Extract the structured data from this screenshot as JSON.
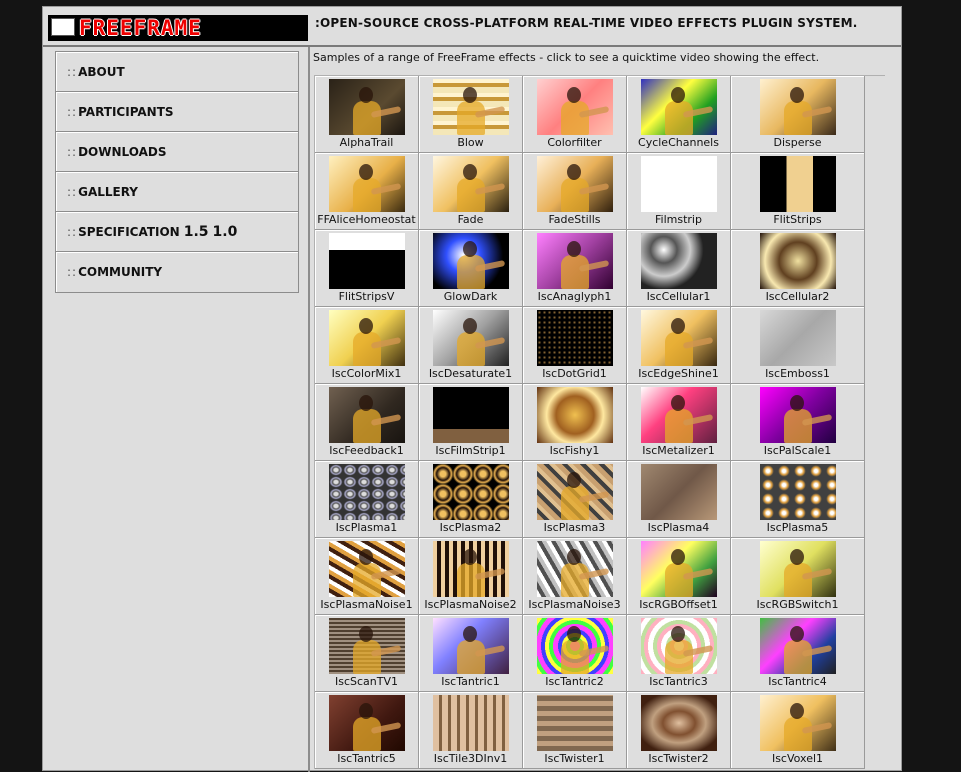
{
  "header": {
    "logo_text": "FREEFRAME",
    "tagline": ":OPEN-SOURCE CROSS-PLATFORM REAL-TIME VIDEO EFFECTS PLUGIN SYSTEM."
  },
  "sidebar": {
    "prefix": "::",
    "items": [
      {
        "label": "ABOUT"
      },
      {
        "label": "PARTICIPANTS"
      },
      {
        "label": "DOWNLOADS"
      },
      {
        "label": "GALLERY"
      },
      {
        "label": "SPECIFICATION",
        "versions": [
          "1.5",
          "1.0"
        ]
      },
      {
        "label": "COMMUNITY"
      }
    ]
  },
  "main": {
    "intro": "Samples of a range of FreeFrame effects - click to see a quicktime video showing the effect."
  },
  "effects": [
    {
      "name": "AlphaTrail",
      "bg": "linear-gradient(135deg,#2a2218,#5a4a30 60%,#1a1510)",
      "fig": true
    },
    {
      "name": "Blow",
      "bg": "repeating-linear-gradient(0deg,#f4e7b8 0 6px,#c89838 6px 10px,#fff4d0 10px 14px)",
      "fig": true
    },
    {
      "name": "Colorfilter",
      "bg": "linear-gradient(135deg,#ffd0d0,#ff8080 50%,#ffc0b0)",
      "fig": true
    },
    {
      "name": "CycleChannels",
      "bg": "linear-gradient(135deg,#3030c0,#ffff40 40%,#20a020 70%,#202080)",
      "fig": true
    },
    {
      "name": "Disperse",
      "bg": "linear-gradient(135deg,#fff0d0,#e8b860 50%,#3a2a1a)",
      "fig": true
    },
    {
      "name": "FFAliceHomeostat",
      "bg": "linear-gradient(135deg,#fff0c0,#e8b048 55%,#3a2a10)",
      "fig": true
    },
    {
      "name": "Fade",
      "bg": "linear-gradient(135deg,#fff6e0,#f0c060 50%,#2a2010)",
      "fig": true
    },
    {
      "name": "FadeStills",
      "bg": "linear-gradient(135deg,#fff0d8,#e8b058 50%,#30200e)",
      "fig": true
    },
    {
      "name": "Filmstrip",
      "bg": "linear-gradient(90deg,#fff,#fff)",
      "fig": false
    },
    {
      "name": "FlitStrips",
      "bg": "linear-gradient(90deg,#000 0 35%,#f0d090 35% 70%,#000 70%)",
      "fig": false
    },
    {
      "name": "FlitStripsV",
      "bg": "linear-gradient(180deg,#fff 0 30%,#000 30%)",
      "fig": false
    },
    {
      "name": "GlowDark",
      "bg": "radial-gradient(circle at 40% 40%,#ffffff,#3050ff 30%,#000 70%)",
      "fig": true
    },
    {
      "name": "IscAnaglyph1",
      "bg": "linear-gradient(135deg,#ff80ff,#a040a0 50%,#300030)",
      "fig": true
    },
    {
      "name": "IscCellular1",
      "bg": "radial-gradient(circle at 30% 30%,#fff,#555 20%,#ccc 40%,#222 60%)",
      "fig": false
    },
    {
      "name": "IscCellular2",
      "bg": "radial-gradient(circle at 50% 50%,#f0e0a0,#604020 40%,#f8e8b0 70%,#201008)",
      "fig": false
    },
    {
      "name": "IscColorMix1",
      "bg": "linear-gradient(135deg,#ffffc0,#f0d050 50%,#403010)",
      "fig": true
    },
    {
      "name": "IscDesaturate1",
      "bg": "linear-gradient(135deg,#ffffff,#a0a0a0 50%,#202020)",
      "fig": true
    },
    {
      "name": "IscDotGrid1",
      "bg": "radial-gradient(circle,#806030 30%,#000 31%) 0 0/5px 5px",
      "fig": false
    },
    {
      "name": "IscEdgeShine1",
      "bg": "linear-gradient(135deg,#fff8e0,#f0c060 50%,#382810)",
      "fig": true
    },
    {
      "name": "IscEmboss1",
      "bg": "linear-gradient(135deg,#d8d8d8,#a8a8a8 50%,#c8c8c8)",
      "fig": false
    },
    {
      "name": "IscFeedback1",
      "bg": "linear-gradient(135deg,#706050,#302820 60%,#181410)",
      "fig": true
    },
    {
      "name": "IscFilmStrip1",
      "bg": "linear-gradient(180deg,#000 0 75%,#806040 75%)",
      "fig": false
    },
    {
      "name": "IscFishy1",
      "bg": "radial-gradient(circle at 50% 50%,#f0c050,#a06020 40%,#ffe8a0 60%,#603010)",
      "fig": false
    },
    {
      "name": "IscMetalizer1",
      "bg": "linear-gradient(135deg,#ffffff,#ff4080 40%,#602040)",
      "fig": true
    },
    {
      "name": "IscPalScale1",
      "bg": "linear-gradient(135deg,#ff00ff,#8000a0 50%,#200040)",
      "fig": true
    },
    {
      "name": "IscPlasma1",
      "bg": "radial-gradient(ellipse,#ddd 20%,#555 35%,#aac 50%,#333 65%) 0 0/14px 12px",
      "fig": false
    },
    {
      "name": "IscPlasma2",
      "bg": "radial-gradient(circle,#f0c060 20%,#201008 45%,#e8b050 60%,#000 75%) 0 0/20px 20px",
      "fig": false
    },
    {
      "name": "IscPlasma3",
      "bg": "repeating-linear-gradient(45deg,#c8a070 0 5px,#404040 5px 9px,#e0c090 9px 13px)",
      "fig": true
    },
    {
      "name": "IscPlasma4",
      "bg": "linear-gradient(135deg,#a08870,#705848 50%,#b89878)",
      "fig": false
    },
    {
      "name": "IscPlasma5",
      "bg": "radial-gradient(circle,#ffffff 15%,#e0a040 35%,#404040 55%) 0 0/16px 14px",
      "fig": false
    },
    {
      "name": "IscPlasmaNoise1",
      "bg": "repeating-linear-gradient(30deg,#fff 0 4px,#402010 4px 8px,#e0a040 8px 12px)",
      "fig": true
    },
    {
      "name": "IscPlasmaNoise2",
      "bg": "repeating-linear-gradient(90deg,#f0d0a0 0 4px,#201008 4px 8px),repeating-linear-gradient(0deg,#a07040 0 5px,transparent 5px 10px)",
      "fig": true
    },
    {
      "name": "IscPlasmaNoise3",
      "bg": "repeating-linear-gradient(60deg,#fff 0 4px,#505050 4px 8px,#c0c0c0 8px 12px)",
      "fig": true
    },
    {
      "name": "IscRGBOffset1",
      "bg": "linear-gradient(135deg,#ff80ff,#ffff60 40%,#40a040 70%,#200020)",
      "fig": true
    },
    {
      "name": "IscRGBSwitch1",
      "bg": "linear-gradient(135deg,#ffffd0,#e0e060 50%,#303010)",
      "fig": true
    },
    {
      "name": "IscScanTV1",
      "bg": "repeating-linear-gradient(0deg,#a09080 0 2px,#504030 2px 4px)",
      "fig": true
    },
    {
      "name": "IscTantric1",
      "bg": "linear-gradient(135deg,#ffe0ff,#8080ff 40%,#402040)",
      "fig": true
    },
    {
      "name": "IscTantric2",
      "bg": "repeating-radial-gradient(circle,#ff40ff 0 5px,#40ff40 5px 9px,#ffff40 9px 13px,#4040ff 13px 17px)",
      "fig": true
    },
    {
      "name": "IscTantric3",
      "bg": "repeating-radial-gradient(circle,#ffffff 0 5px,#ffb0c0 5px 9px,#c0e0a0 9px 13px)",
      "fig": true
    },
    {
      "name": "IscTantric4",
      "bg": "linear-gradient(135deg,#40c040,#ff40ff 40%,#2040a0 70%,#202020)",
      "fig": true
    },
    {
      "name": "IscTantric5",
      "bg": "linear-gradient(135deg,#804030,#401810 60%,#200800)",
      "fig": true
    },
    {
      "name": "IscTile3DInv1",
      "bg": "repeating-linear-gradient(90deg,#e0c0a0 0 6px,#806040 6px 9px),linear-gradient(#c09070,#604030)",
      "fig": false
    },
    {
      "name": "IscTwister1",
      "bg": "repeating-linear-gradient(0deg,#806850 0 5px,#c0a080 5px 10px)",
      "fig": false
    },
    {
      "name": "IscTwister2",
      "bg": "radial-gradient(ellipse at 50% 50%,#e0c0a0,#805030 30%,#c0a080 50%,#402010 80%)",
      "fig": false
    },
    {
      "name": "IscVoxel1",
      "bg": "linear-gradient(135deg,#fff0d0,#f0c060 50%,#403018)",
      "fig": true
    }
  ]
}
